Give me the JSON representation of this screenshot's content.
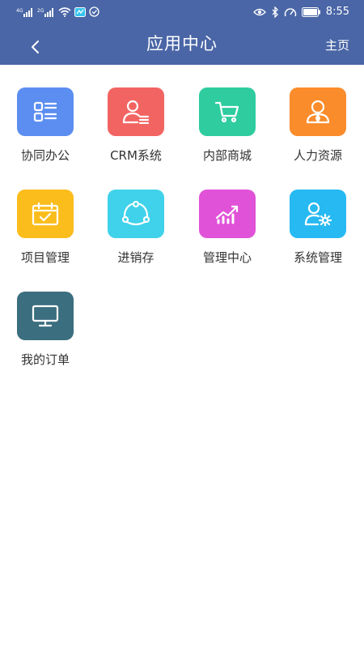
{
  "status_bar": {
    "time": "8:55",
    "signal_1_label": "4G",
    "signal_2_label": "2G",
    "icons": [
      "signal-icon",
      "signal-icon",
      "wifi-icon",
      "notification-icon",
      "notification-icon",
      "eye-icon",
      "bluetooth-icon",
      "speed-icon",
      "battery-icon"
    ]
  },
  "header": {
    "title": "应用中心",
    "home_label": "主页",
    "back_icon": "chevron-left-icon",
    "background": "#4a66a6"
  },
  "apps": [
    {
      "label": "协同办公",
      "icon": "list-grid-icon",
      "color": "#5b8ef0"
    },
    {
      "label": "CRM系统",
      "icon": "user-list-icon",
      "color": "#f26462"
    },
    {
      "label": "内部商城",
      "icon": "cart-icon",
      "color": "#2ecc9f"
    },
    {
      "label": "人力资源",
      "icon": "person-tie-icon",
      "color": "#fb8c2b"
    },
    {
      "label": "项目管理",
      "icon": "calendar-check-icon",
      "color": "#fbbd1c"
    },
    {
      "label": "进销存",
      "icon": "cycle-icon",
      "color": "#3fd2ea"
    },
    {
      "label": "管理中心",
      "icon": "bar-chart-icon",
      "color": "#e052d8"
    },
    {
      "label": "系统管理",
      "icon": "user-gear-icon",
      "color": "#27b9f2"
    },
    {
      "label": "我的订单",
      "icon": "monitor-icon",
      "color": "#3b6e7f"
    }
  ]
}
